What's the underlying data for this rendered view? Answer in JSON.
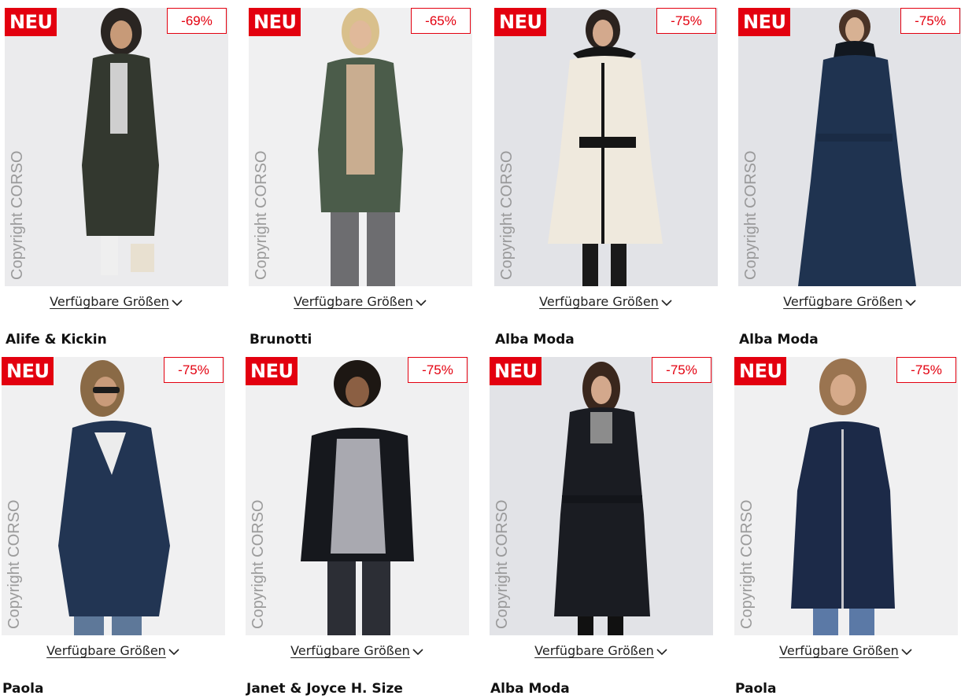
{
  "labels": {
    "new_badge": "NEU",
    "sizes_link": "Verfügbare Größen",
    "watermark": "Copyright CORSO"
  },
  "colors": {
    "accent_red": "#e3000f",
    "text": "#222222"
  },
  "products": [
    {
      "brand": "Alife & Kickin",
      "discount": "-69%",
      "coat_color": "#33382f",
      "chevron_icon": "chevron-down-icon"
    },
    {
      "brand": "Brunotti",
      "discount": "-65%",
      "coat_color": "#4b5c4a",
      "chevron_icon": "chevron-down-icon"
    },
    {
      "brand": "Alba Moda",
      "discount": "-75%",
      "coat_color": "#efe9dd",
      "chevron_icon": "chevron-down-icon"
    },
    {
      "brand": "Alba Moda",
      "discount": "-75%",
      "coat_color": "#1f3350",
      "chevron_icon": "chevron-down-icon"
    },
    {
      "brand": "Paola",
      "discount": "-75%",
      "coat_color": "#223553",
      "chevron_icon": "chevron-down-icon"
    },
    {
      "brand": "Janet & Joyce H. Size",
      "discount": "-75%",
      "coat_color": "#16181d",
      "chevron_icon": "chevron-down-icon"
    },
    {
      "brand": "Alba Moda",
      "discount": "-75%",
      "coat_color": "#1a1c22",
      "chevron_icon": "chevron-down-icon"
    },
    {
      "brand": "Paola",
      "discount": "-75%",
      "coat_color": "#1c2a48",
      "chevron_icon": "chevron-down-icon"
    }
  ]
}
